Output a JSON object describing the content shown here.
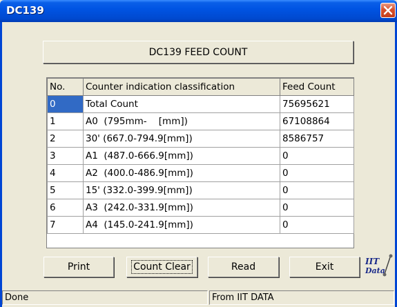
{
  "window": {
    "title": "DC139"
  },
  "header": {
    "label": "DC139 FEED COUNT"
  },
  "table": {
    "columns": [
      "No.",
      "Counter indication classification",
      "Feed Count"
    ],
    "rows": [
      {
        "no": "0",
        "classification": "Total Count",
        "count": "75695621"
      },
      {
        "no": "1",
        "classification": "A0  (795mm-    [mm])",
        "count": "67108864"
      },
      {
        "no": "2",
        "classification": "30' (667.0-794.9[mm])",
        "count": "8586757"
      },
      {
        "no": "3",
        "classification": "A1  (487.0-666.9[mm])",
        "count": "0"
      },
      {
        "no": "4",
        "classification": "A2  (400.0-486.9[mm])",
        "count": "0"
      },
      {
        "no": "5",
        "classification": "15' (332.0-399.9[mm])",
        "count": "0"
      },
      {
        "no": "6",
        "classification": "A3  (242.0-331.9[mm])",
        "count": "0"
      },
      {
        "no": "7",
        "classification": "A4  (145.0-241.9[mm])",
        "count": "0"
      }
    ]
  },
  "buttons": {
    "print": "Print",
    "count_clear": "Count Clear",
    "read": "Read",
    "exit": "Exit"
  },
  "logo": {
    "text": "IIT Data"
  },
  "status": {
    "left": "Done",
    "right": "From IIT DATA"
  },
  "colors": {
    "selection": "#316ac5",
    "titlebar": "#0054e3",
    "face": "#ece9d8"
  }
}
